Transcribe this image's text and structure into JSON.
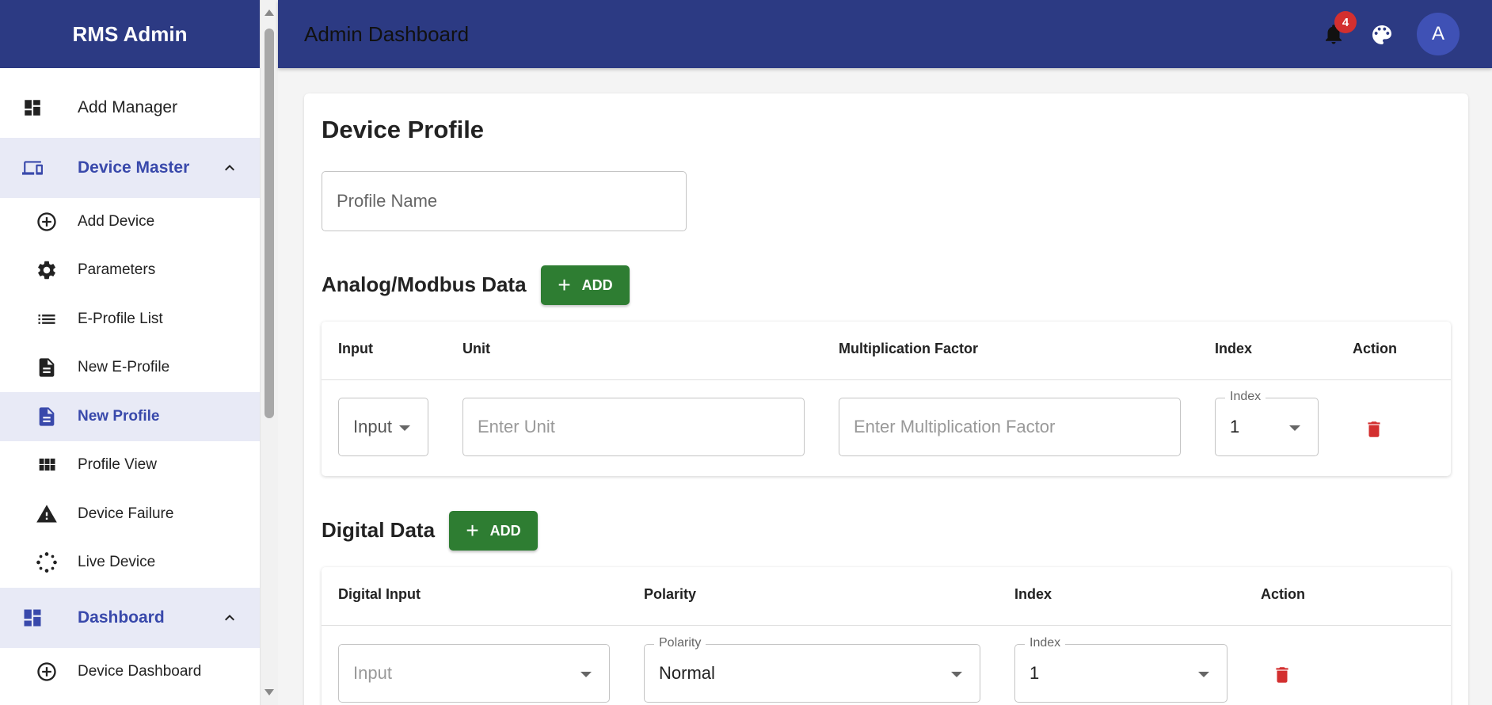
{
  "sidebar": {
    "brand": "RMS Admin",
    "items": [
      {
        "label": "Add Manager"
      },
      {
        "label": "Device Master"
      },
      {
        "label": "Add Device"
      },
      {
        "label": "Parameters"
      },
      {
        "label": "E-Profile List"
      },
      {
        "label": "New E-Profile"
      },
      {
        "label": "New Profile"
      },
      {
        "label": "Profile View"
      },
      {
        "label": "Device Failure"
      },
      {
        "label": "Live Device"
      },
      {
        "label": "Dashboard"
      },
      {
        "label": "Device Dashboard"
      }
    ]
  },
  "header": {
    "title": "Admin Dashboard",
    "notification_count": "4",
    "avatar_letter": "A"
  },
  "main": {
    "page_title": "Device Profile",
    "profile_name_placeholder": "Profile Name",
    "analog": {
      "title": "Analog/Modbus Data",
      "add_label": "ADD",
      "columns": [
        "Input",
        "Unit",
        "Multiplication Factor",
        "Index",
        "Action"
      ],
      "row": {
        "input_value": "Input",
        "unit_placeholder": "Enter Unit",
        "factor_placeholder": "Enter Multiplication Factor",
        "index_label": "Index",
        "index_value": "1"
      }
    },
    "digital": {
      "title": "Digital Data",
      "add_label": "ADD",
      "columns": [
        "Digital Input",
        "Polarity",
        "Index",
        "Action"
      ],
      "row": {
        "input_value": "Input",
        "polarity_label": "Polarity",
        "polarity_value": "Normal",
        "index_label": "Index",
        "index_value": "1"
      }
    }
  },
  "colors": {
    "brand_bar": "#2c3a83",
    "active_text": "#3949ab",
    "active_bg": "#e8eaf6",
    "add_button": "#2e7d32",
    "delete_icon": "#d32f2f",
    "badge": "#d32f2f"
  }
}
